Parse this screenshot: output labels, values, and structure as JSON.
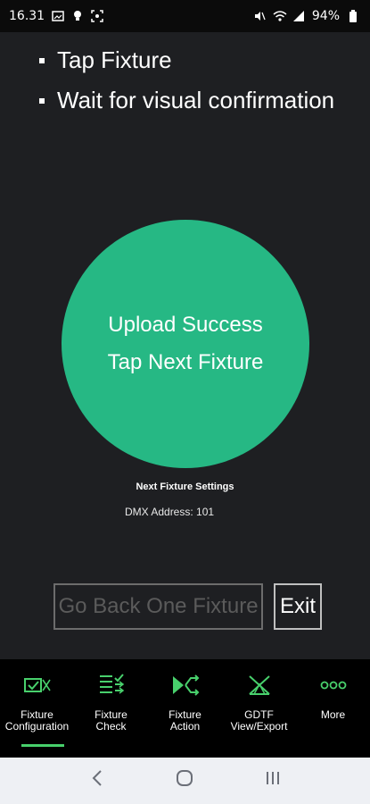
{
  "status_bar": {
    "time": "16.31",
    "battery": "94%",
    "icons_left": [
      "image-icon",
      "location-icon",
      "screenshot-icon"
    ],
    "icons_right": [
      "mute-icon",
      "wifi-icon",
      "signal-icon",
      "battery-icon"
    ]
  },
  "instructions": [
    "Tap Fixture",
    "Wait for visual confirmation"
  ],
  "status_circle": {
    "line1": "Upload Success",
    "line2": "Tap Next Fixture",
    "color": "#26b884"
  },
  "next_settings": {
    "title": "Next Fixture Settings",
    "dmx": "DMX Address: 101"
  },
  "buttons": {
    "back": "Go Back One Fixture",
    "exit": "Exit"
  },
  "nav": [
    {
      "label": "Fixture\nConfiguration",
      "icon": "fixture-config-icon"
    },
    {
      "label": "Fixture\nCheck",
      "icon": "checklist-icon"
    },
    {
      "label": "Fixture\nAction",
      "icon": "action-arrows-icon"
    },
    {
      "label": "GDTF\nView/Export",
      "icon": "gdtf-icon"
    },
    {
      "label": "More",
      "icon": "more-icon"
    }
  ],
  "accent_color": "#48d06c",
  "system_nav": {
    "back": "back-icon",
    "home": "home-icon",
    "recents": "recents-icon"
  }
}
